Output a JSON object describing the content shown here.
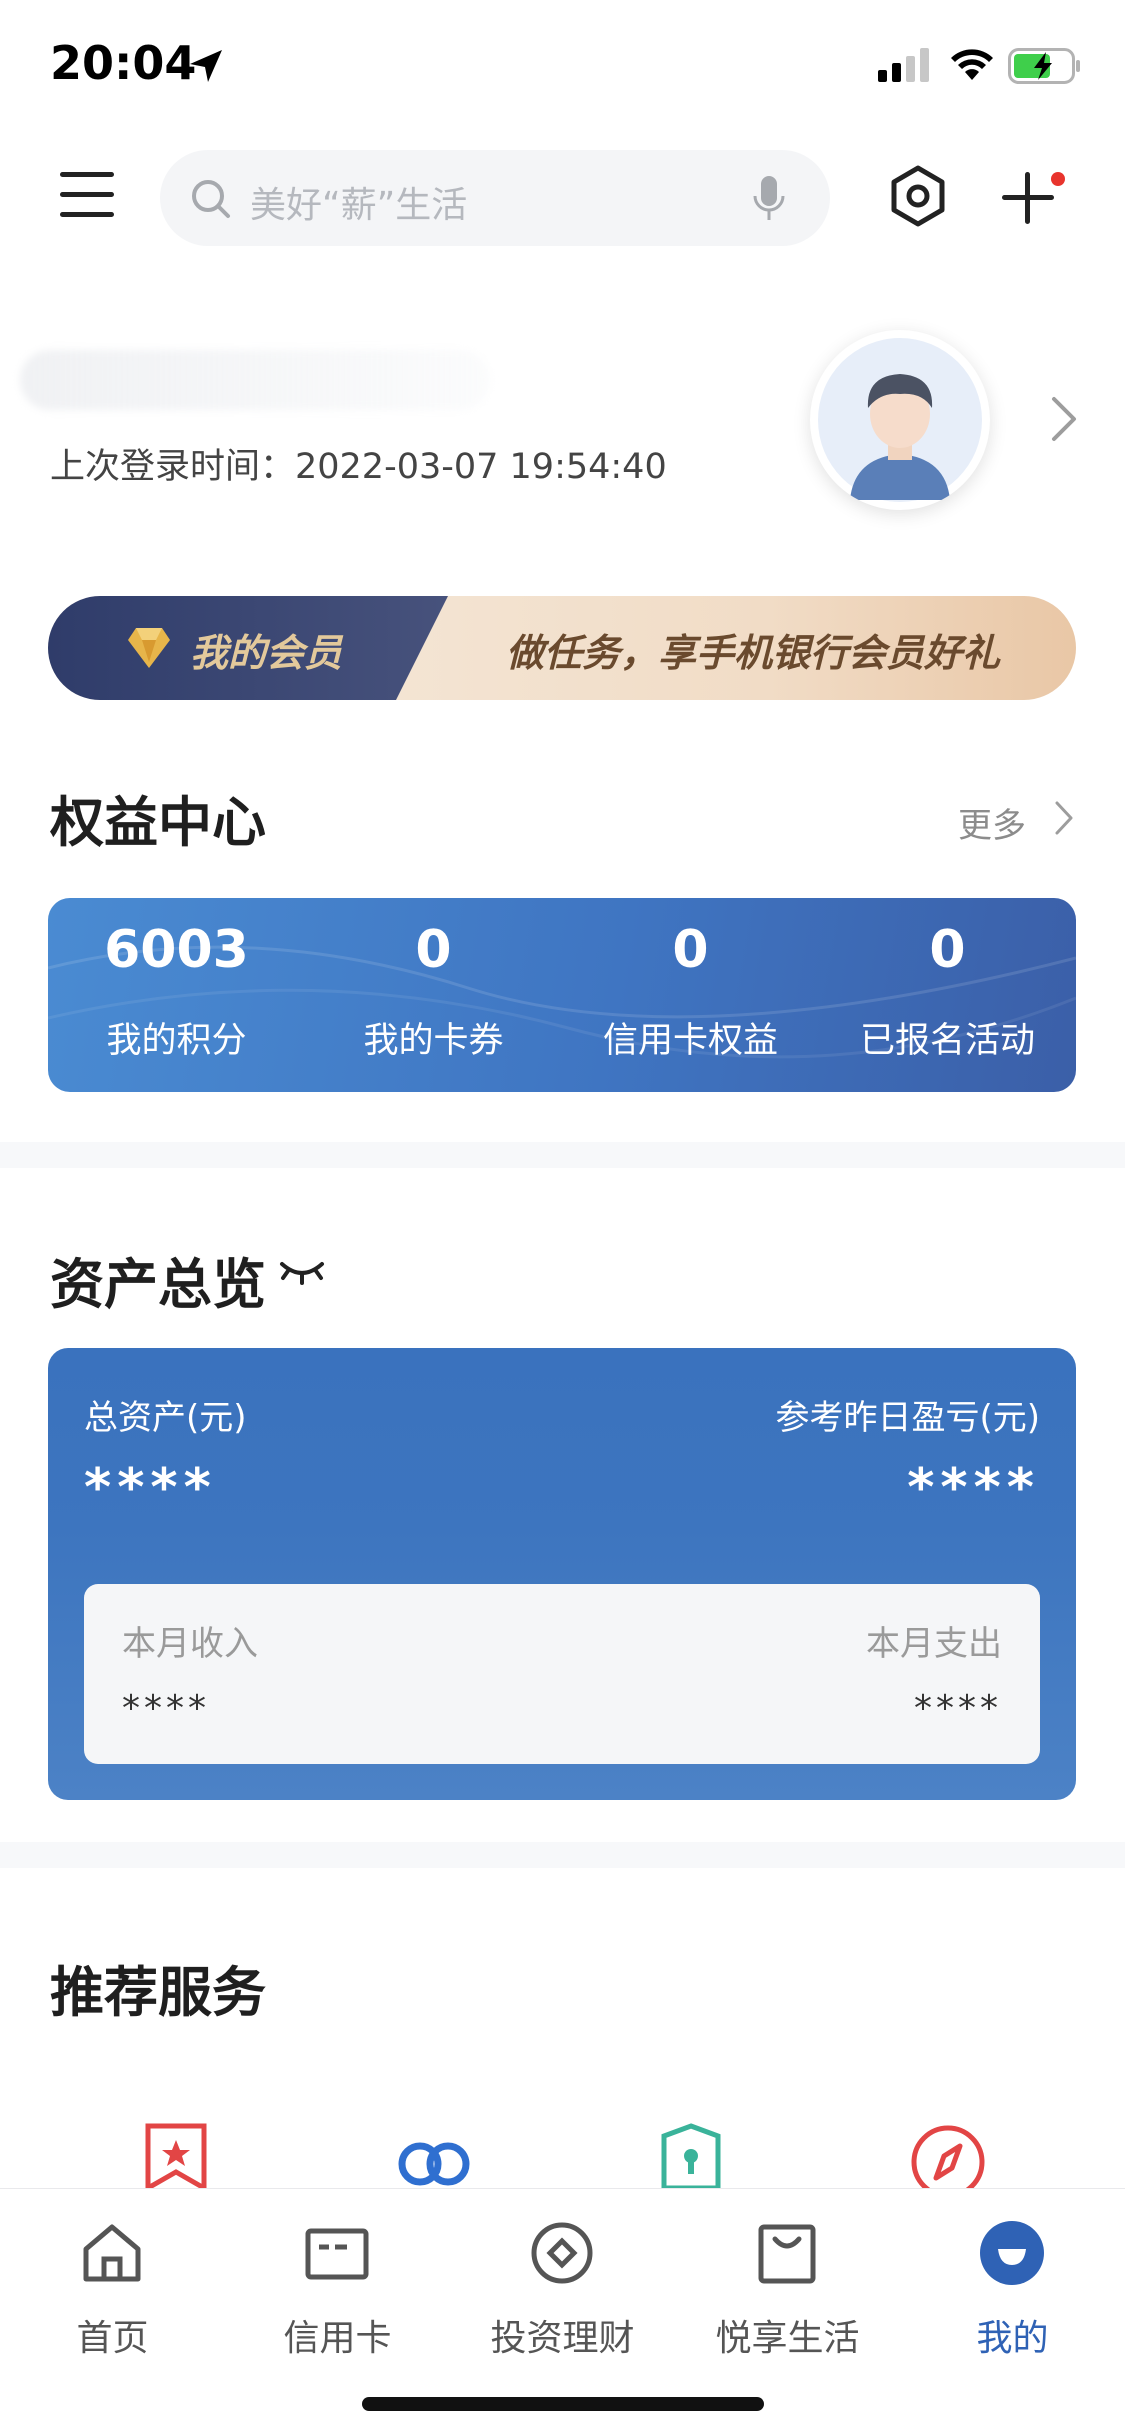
{
  "status_bar": {
    "time": "20:04"
  },
  "search": {
    "placeholder": "美好“薪”生活"
  },
  "profile": {
    "last_login": "上次登录时间：2022-03-07 19:54:40"
  },
  "member_banner": {
    "label": "我的会员",
    "promo": "做任务，享手机银行会员好礼"
  },
  "benefits": {
    "title": "权益中心",
    "more": "更多",
    "items": [
      {
        "value": "6003",
        "label": "我的积分"
      },
      {
        "value": "0",
        "label": "我的卡券"
      },
      {
        "value": "0",
        "label": "信用卡权益"
      },
      {
        "value": "0",
        "label": "已报名活动"
      }
    ]
  },
  "assets": {
    "title": "资产总览",
    "total_label": "总资产(元)",
    "total_value": "****",
    "pl_label": "参考昨日盈亏(元)",
    "pl_value": "****",
    "income_label": "本月收入",
    "income_value": "****",
    "expense_label": "本月支出",
    "expense_value": "****"
  },
  "services": {
    "title": "推荐服务"
  },
  "tabs": [
    {
      "label": "首页",
      "icon": "home-icon"
    },
    {
      "label": "信用卡",
      "icon": "credit-card-icon"
    },
    {
      "label": "投资理财",
      "icon": "investment-icon"
    },
    {
      "label": "悦享生活",
      "icon": "shopping-bag-icon"
    },
    {
      "label": "我的",
      "icon": "profile-icon",
      "active": true
    }
  ],
  "colors": {
    "accent": "#2f62b5",
    "card_blue": "#3f75c2",
    "badge_red": "#e8342d"
  }
}
